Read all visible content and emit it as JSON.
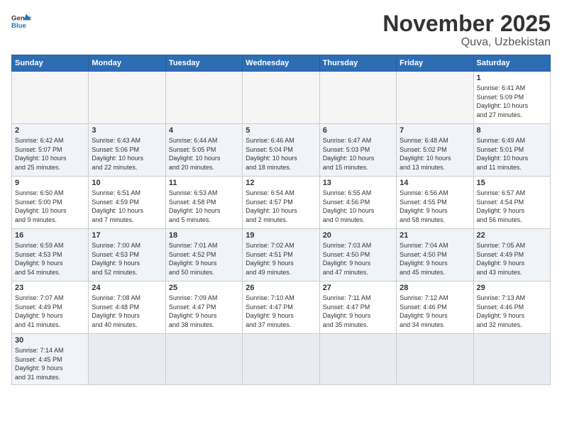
{
  "header": {
    "logo_general": "General",
    "logo_blue": "Blue",
    "month_title": "November 2025",
    "location": "Quva, Uzbekistan"
  },
  "weekdays": [
    "Sunday",
    "Monday",
    "Tuesday",
    "Wednesday",
    "Thursday",
    "Friday",
    "Saturday"
  ],
  "days": [
    {
      "num": "",
      "info": ""
    },
    {
      "num": "",
      "info": ""
    },
    {
      "num": "",
      "info": ""
    },
    {
      "num": "",
      "info": ""
    },
    {
      "num": "",
      "info": ""
    },
    {
      "num": "",
      "info": ""
    },
    {
      "num": "1",
      "info": "Sunrise: 6:41 AM\nSunset: 5:09 PM\nDaylight: 10 hours\nand 27 minutes."
    },
    {
      "num": "2",
      "info": "Sunrise: 6:42 AM\nSunset: 5:07 PM\nDaylight: 10 hours\nand 25 minutes."
    },
    {
      "num": "3",
      "info": "Sunrise: 6:43 AM\nSunset: 5:06 PM\nDaylight: 10 hours\nand 22 minutes."
    },
    {
      "num": "4",
      "info": "Sunrise: 6:44 AM\nSunset: 5:05 PM\nDaylight: 10 hours\nand 20 minutes."
    },
    {
      "num": "5",
      "info": "Sunrise: 6:46 AM\nSunset: 5:04 PM\nDaylight: 10 hours\nand 18 minutes."
    },
    {
      "num": "6",
      "info": "Sunrise: 6:47 AM\nSunset: 5:03 PM\nDaylight: 10 hours\nand 15 minutes."
    },
    {
      "num": "7",
      "info": "Sunrise: 6:48 AM\nSunset: 5:02 PM\nDaylight: 10 hours\nand 13 minutes."
    },
    {
      "num": "8",
      "info": "Sunrise: 6:49 AM\nSunset: 5:01 PM\nDaylight: 10 hours\nand 11 minutes."
    },
    {
      "num": "9",
      "info": "Sunrise: 6:50 AM\nSunset: 5:00 PM\nDaylight: 10 hours\nand 9 minutes."
    },
    {
      "num": "10",
      "info": "Sunrise: 6:51 AM\nSunset: 4:59 PM\nDaylight: 10 hours\nand 7 minutes."
    },
    {
      "num": "11",
      "info": "Sunrise: 6:53 AM\nSunset: 4:58 PM\nDaylight: 10 hours\nand 5 minutes."
    },
    {
      "num": "12",
      "info": "Sunrise: 6:54 AM\nSunset: 4:57 PM\nDaylight: 10 hours\nand 2 minutes."
    },
    {
      "num": "13",
      "info": "Sunrise: 6:55 AM\nSunset: 4:56 PM\nDaylight: 10 hours\nand 0 minutes."
    },
    {
      "num": "14",
      "info": "Sunrise: 6:56 AM\nSunset: 4:55 PM\nDaylight: 9 hours\nand 58 minutes."
    },
    {
      "num": "15",
      "info": "Sunrise: 6:57 AM\nSunset: 4:54 PM\nDaylight: 9 hours\nand 56 minutes."
    },
    {
      "num": "16",
      "info": "Sunrise: 6:59 AM\nSunset: 4:53 PM\nDaylight: 9 hours\nand 54 minutes."
    },
    {
      "num": "17",
      "info": "Sunrise: 7:00 AM\nSunset: 4:53 PM\nDaylight: 9 hours\nand 52 minutes."
    },
    {
      "num": "18",
      "info": "Sunrise: 7:01 AM\nSunset: 4:52 PM\nDaylight: 9 hours\nand 50 minutes."
    },
    {
      "num": "19",
      "info": "Sunrise: 7:02 AM\nSunset: 4:51 PM\nDaylight: 9 hours\nand 49 minutes."
    },
    {
      "num": "20",
      "info": "Sunrise: 7:03 AM\nSunset: 4:50 PM\nDaylight: 9 hours\nand 47 minutes."
    },
    {
      "num": "21",
      "info": "Sunrise: 7:04 AM\nSunset: 4:50 PM\nDaylight: 9 hours\nand 45 minutes."
    },
    {
      "num": "22",
      "info": "Sunrise: 7:05 AM\nSunset: 4:49 PM\nDaylight: 9 hours\nand 43 minutes."
    },
    {
      "num": "23",
      "info": "Sunrise: 7:07 AM\nSunset: 4:49 PM\nDaylight: 9 hours\nand 41 minutes."
    },
    {
      "num": "24",
      "info": "Sunrise: 7:08 AM\nSunset: 4:48 PM\nDaylight: 9 hours\nand 40 minutes."
    },
    {
      "num": "25",
      "info": "Sunrise: 7:09 AM\nSunset: 4:47 PM\nDaylight: 9 hours\nand 38 minutes."
    },
    {
      "num": "26",
      "info": "Sunrise: 7:10 AM\nSunset: 4:47 PM\nDaylight: 9 hours\nand 37 minutes."
    },
    {
      "num": "27",
      "info": "Sunrise: 7:11 AM\nSunset: 4:47 PM\nDaylight: 9 hours\nand 35 minutes."
    },
    {
      "num": "28",
      "info": "Sunrise: 7:12 AM\nSunset: 4:46 PM\nDaylight: 9 hours\nand 34 minutes."
    },
    {
      "num": "29",
      "info": "Sunrise: 7:13 AM\nSunset: 4:46 PM\nDaylight: 9 hours\nand 32 minutes."
    },
    {
      "num": "30",
      "info": "Sunrise: 7:14 AM\nSunset: 4:45 PM\nDaylight: 9 hours\nand 31 minutes."
    }
  ]
}
